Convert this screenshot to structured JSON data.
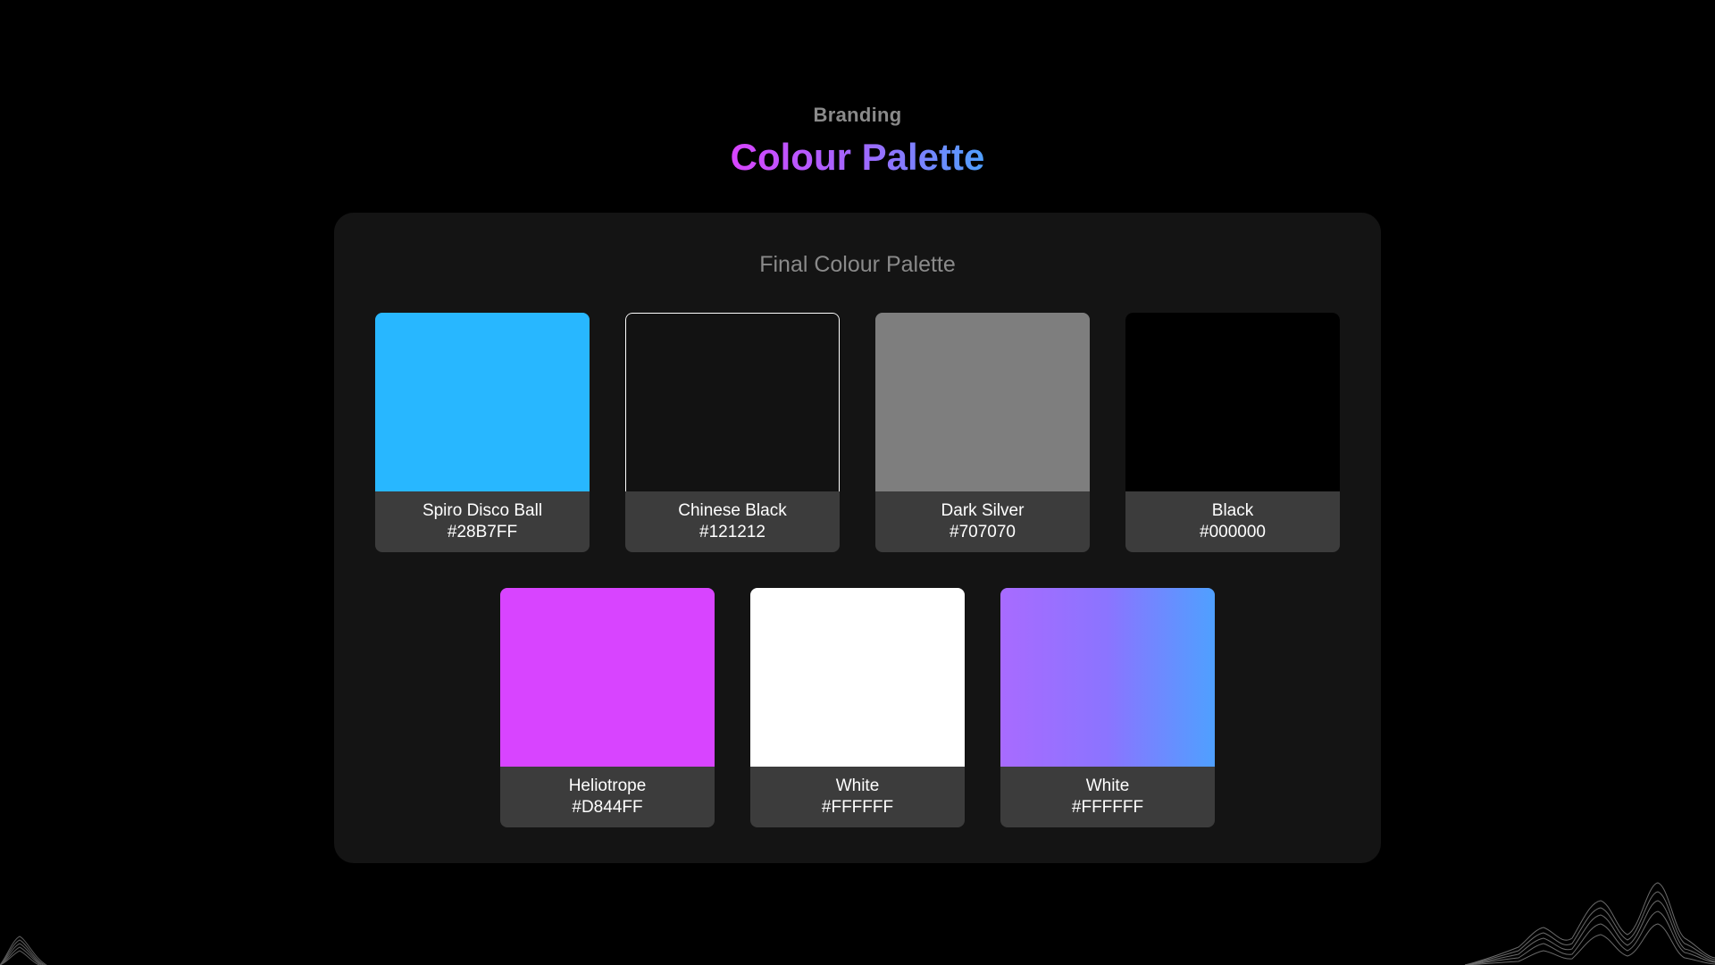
{
  "header": {
    "eyebrow": "Branding",
    "title": "Colour Palette"
  },
  "panel": {
    "title": "Final Colour Palette"
  },
  "swatches": [
    {
      "name": "Spiro Disco Ball",
      "hex": "#28B7FF",
      "fill": "#28B7FF"
    },
    {
      "name": "Chinese Black",
      "hex": "#121212",
      "fill": "#121212",
      "outlined": true
    },
    {
      "name": "Dark Silver",
      "hex": "#707070",
      "fill": "#7E7E7E"
    },
    {
      "name": "Black",
      "hex": "#000000",
      "fill": "#000000"
    },
    {
      "name": "Heliotrope",
      "hex": "#D844FF",
      "fill": "#D844FF"
    },
    {
      "name": "White",
      "hex": "#FFFFFF",
      "fill": "#FFFFFF"
    },
    {
      "name": "White",
      "hex": "#FFFFFF",
      "fill_gradient": [
        "#A86BFF",
        "#8B74FF",
        "#4FA0FF"
      ]
    }
  ],
  "colors": {
    "page_background": "#000000",
    "panel_background": "#141414",
    "label_background": "#3C3C3C",
    "title_gradient": [
      "#D844FF",
      "#9B6BFF",
      "#4FA0FF"
    ]
  },
  "decorations": [
    "wave-lines-left",
    "wave-lines-right"
  ]
}
